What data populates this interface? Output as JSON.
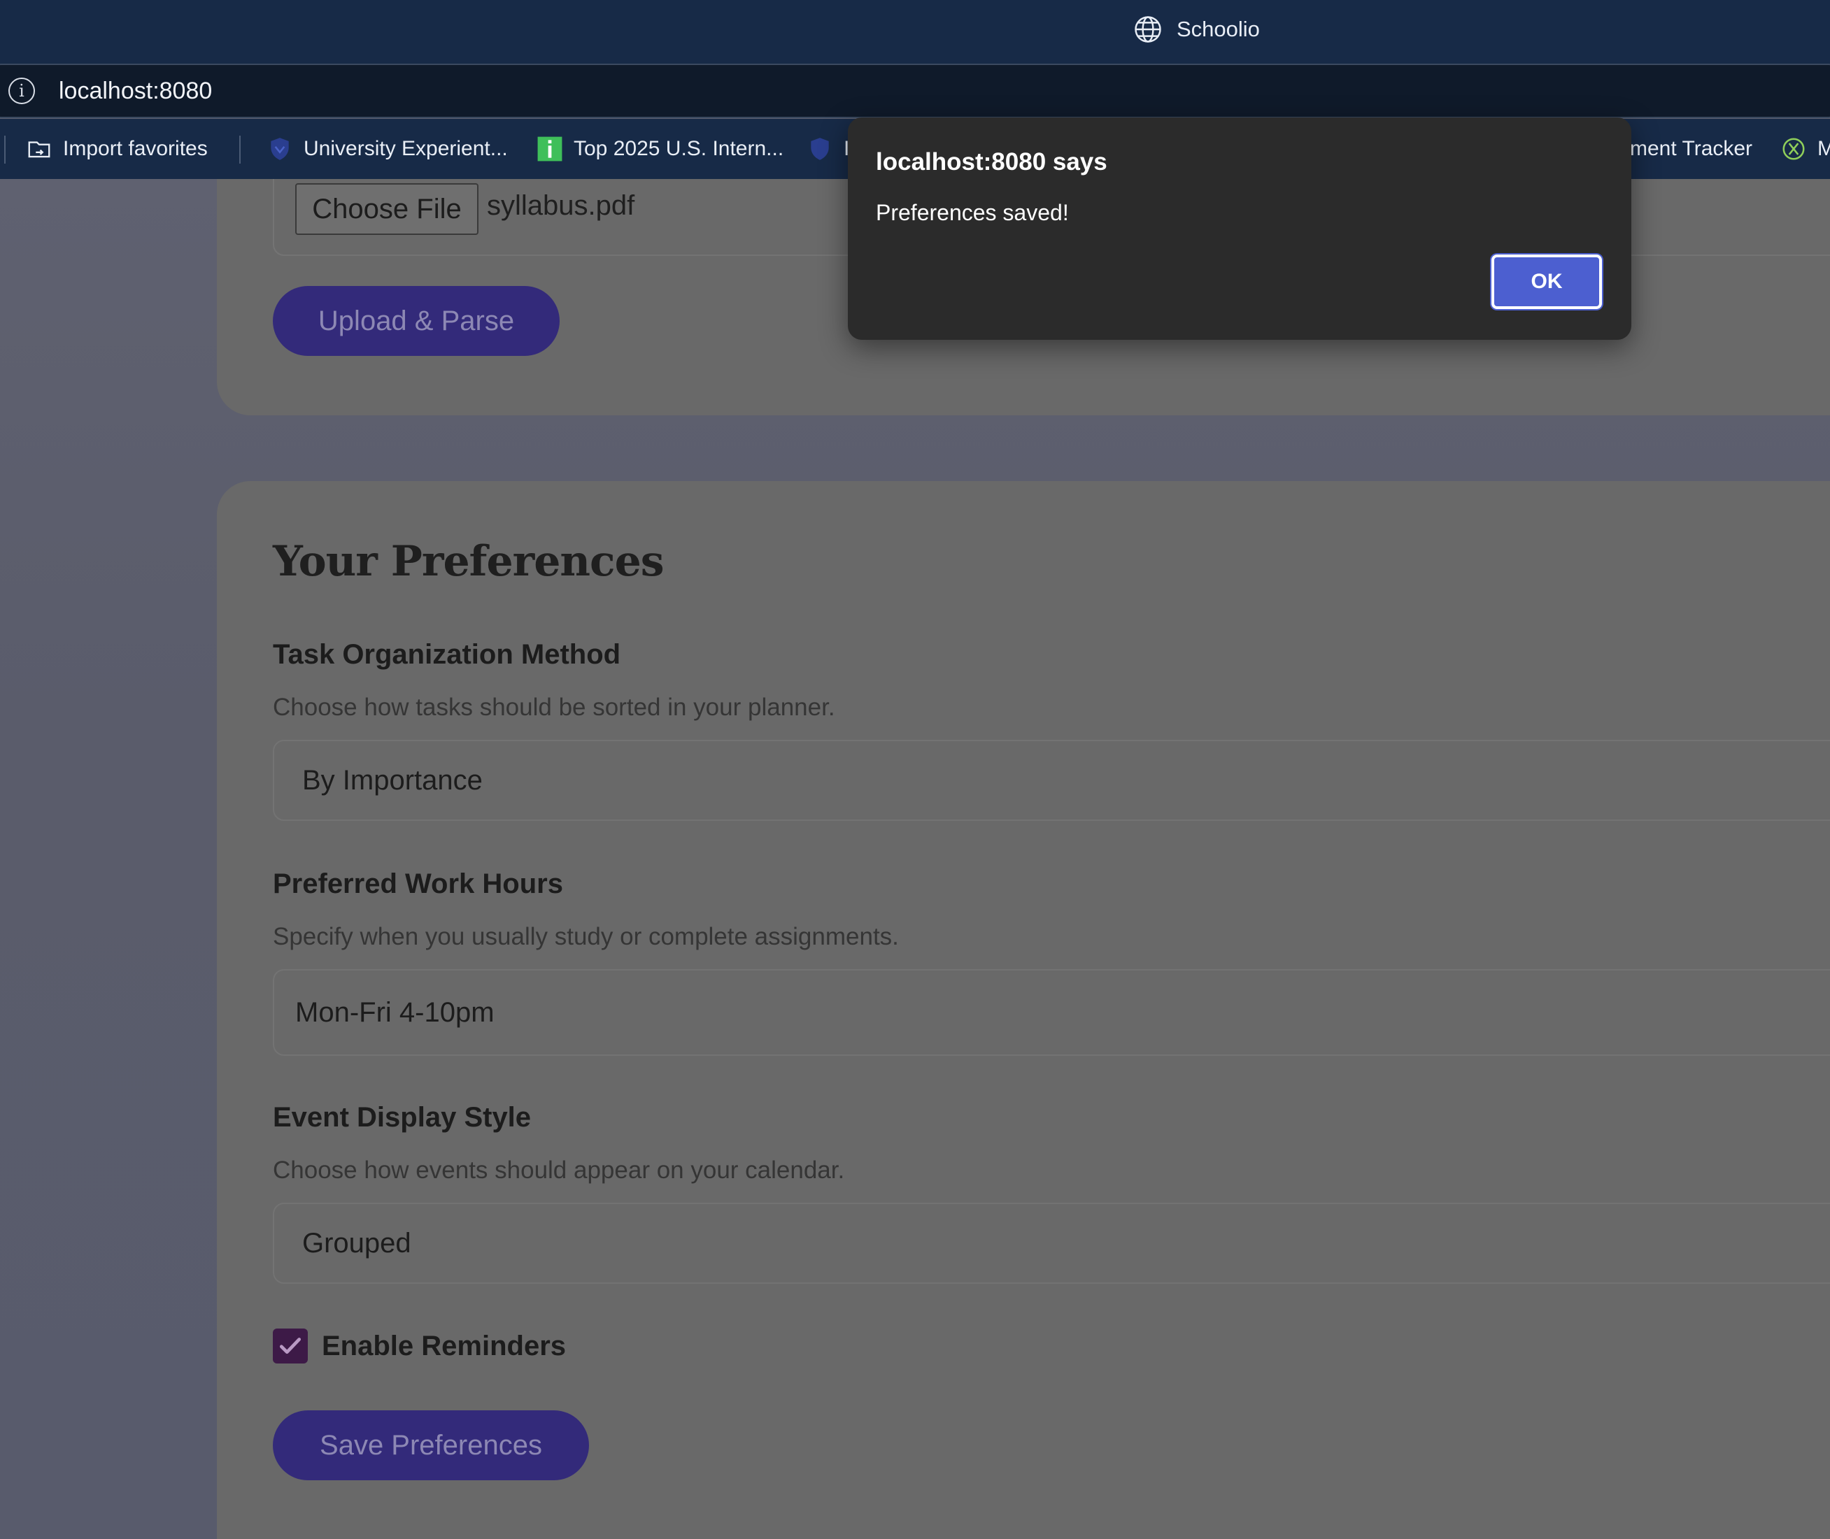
{
  "window": {
    "title": "Schoolio"
  },
  "address_bar": {
    "url": "localhost:8080"
  },
  "bookmarks": [
    {
      "label": "Import favorites",
      "icon": "import-favorites-icon"
    },
    {
      "label": "University Experient...",
      "icon": "shield-icon"
    },
    {
      "label": "Top 2025 U.S. Intern...",
      "icon": "info-tile-icon"
    },
    {
      "label": "I",
      "icon": "shield-icon"
    },
    {
      "label": "ment Tracker",
      "icon": ""
    },
    {
      "label": "M",
      "icon": "x-circle-icon"
    }
  ],
  "upload": {
    "choose_file_label": "Choose File",
    "file_name": "syllabus.pdf",
    "upload_button": "Upload & Parse"
  },
  "preferences": {
    "heading": "Your Preferences",
    "task_org": {
      "label": "Task Organization Method",
      "hint": "Choose how tasks should be sorted in your planner.",
      "value": "By Importance"
    },
    "work_hours": {
      "label": "Preferred Work Hours",
      "hint": "Specify when you usually study or complete assignments.",
      "value": "Mon-Fri 4-10pm"
    },
    "display_style": {
      "label": "Event Display Style",
      "hint": "Choose how events should appear on your calendar.",
      "value": "Grouped"
    },
    "reminders": {
      "label": "Enable Reminders",
      "checked": true
    },
    "save_button": "Save Preferences"
  },
  "dialog": {
    "title": "localhost:8080 says",
    "message": "Preferences saved!",
    "ok_label": "OK"
  },
  "colors": {
    "chrome": "#172a47",
    "primary_button": "#332a7a",
    "dialog_ok": "#4c5fd0",
    "checkbox": "#3d1a47"
  }
}
